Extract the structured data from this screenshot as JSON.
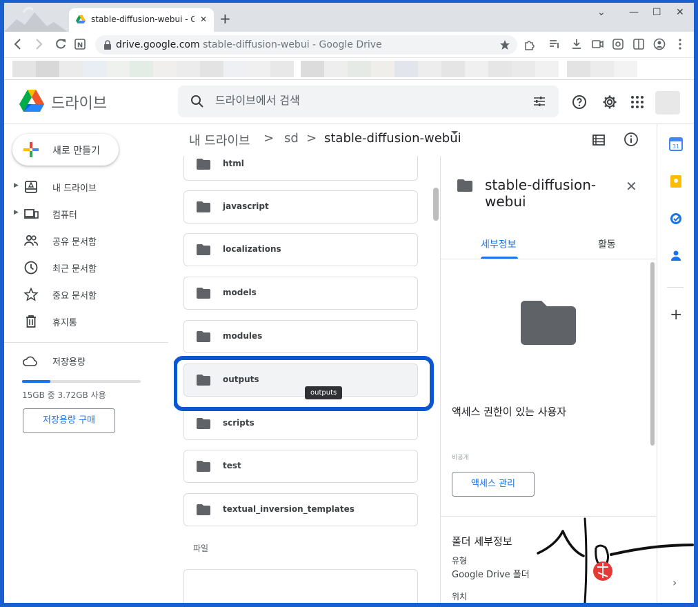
{
  "browser": {
    "tab_title": "stable-diffusion-webui - Google Drive",
    "new_tab": "+",
    "url_domain": "drive.google.com",
    "url_rest": "stable-diffusion-webui - Google Drive",
    "win_minimize": "—",
    "win_maximize": "☐",
    "win_close": "✕",
    "tab_close": "✕",
    "tab_list": "⌄"
  },
  "drive": {
    "app_name": "드라이브",
    "search_placeholder": "드라이브에서 검색"
  },
  "sidebar": {
    "new_button": "새로 만들기",
    "items": [
      {
        "label": "내 드라이브",
        "icon": "my-drive-icon",
        "caret": "▶"
      },
      {
        "label": "컴퓨터",
        "icon": "computer-icon",
        "caret": "▶"
      },
      {
        "label": "공유 문서함",
        "icon": "shared-icon",
        "caret": ""
      },
      {
        "label": "최근 문서함",
        "icon": "recent-icon",
        "caret": ""
      },
      {
        "label": "중요 문서함",
        "icon": "star-icon",
        "caret": ""
      },
      {
        "label": "휴지통",
        "icon": "trash-icon",
        "caret": ""
      }
    ],
    "storage_label": "저장용량",
    "storage_used_fraction": 0.24,
    "storage_text": "15GB 중 3.72GB 사용",
    "buy_storage": "저장용량 구매"
  },
  "breadcrumb": {
    "root": "내 드라이브",
    "sep": ">",
    "middle": "sd",
    "current": "stable-diffusion-webui"
  },
  "folders": [
    "html",
    "javascript",
    "localizations",
    "models",
    "modules",
    "outputs",
    "scripts",
    "test",
    "textual_inversion_templates"
  ],
  "files_section_label": "파일",
  "tooltip": "outputs",
  "details": {
    "title": "stable-diffusion-webui",
    "close": "✕",
    "tab_details": "세부정보",
    "tab_activity": "활동",
    "access_heading": "액세스 권한이 있는 사용자",
    "access_faint": "비공개",
    "manage_access": "액세스 관리",
    "folder_details_heading": "폴더 세부정보",
    "type_label": "유형",
    "type_value": "Google Drive 폴더",
    "location_label": "위치"
  },
  "sidepanel": {
    "plus": "+",
    "chevron": "›"
  },
  "colors": {
    "accent": "#1a73e8",
    "highlight": "#0b57d0",
    "folder": "#5f6368",
    "frame": "#1a5fd0"
  }
}
